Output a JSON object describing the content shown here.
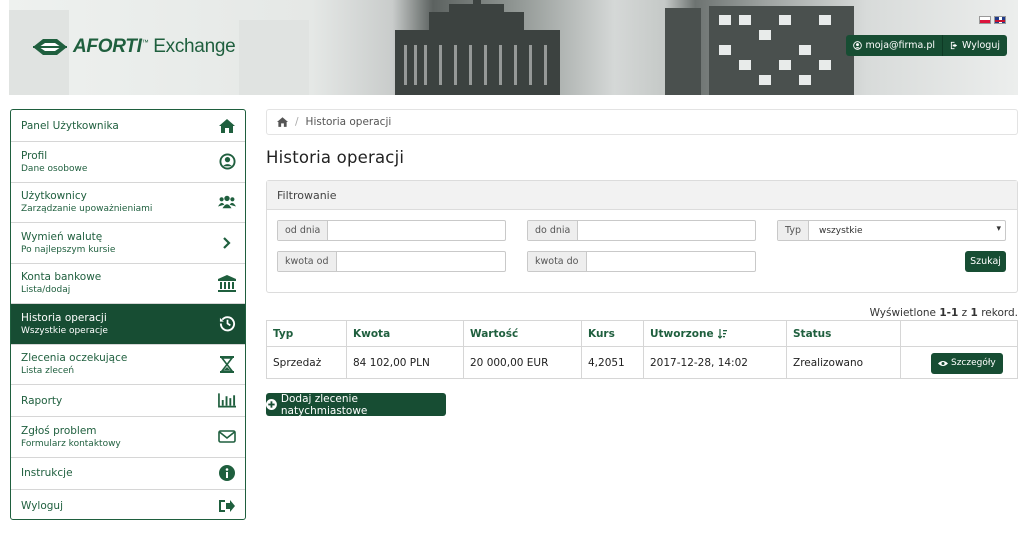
{
  "header": {
    "logo_brand": "AFORTI",
    "logo_tm": "™",
    "logo_suffix": "Exchange",
    "user_email": "moja@firma.pl",
    "logout_label": "Wyloguj",
    "languages": [
      "pl",
      "en"
    ]
  },
  "sidebar": {
    "items": [
      {
        "label": "Panel Użytkownika",
        "sub": "",
        "icon": "home-icon"
      },
      {
        "label": "Profil",
        "sub": "Dane osobowe",
        "icon": "user-circle-icon"
      },
      {
        "label": "Użytkownicy",
        "sub": "Zarządzanie upoważnieniami",
        "icon": "users-icon"
      },
      {
        "label": "Wymień walutę",
        "sub": "Po najlepszym kursie",
        "icon": "chevron-right-icon"
      },
      {
        "label": "Konta bankowe",
        "sub": "Lista/dodaj",
        "icon": "bank-icon"
      },
      {
        "label": "Historia operacji",
        "sub": "Wszystkie operacje",
        "icon": "history-icon",
        "active": true
      },
      {
        "label": "Zlecenia oczekujące",
        "sub": "Lista zleceń",
        "icon": "hourglass-icon"
      },
      {
        "label": "Raporty",
        "sub": "",
        "icon": "bar-chart-icon"
      },
      {
        "label": "Zgłoś problem",
        "sub": "Formularz kontaktowy",
        "icon": "envelope-icon"
      },
      {
        "label": "Instrukcje",
        "sub": "",
        "icon": "info-icon"
      },
      {
        "label": "Wyloguj",
        "sub": "",
        "icon": "sign-out-icon"
      }
    ]
  },
  "breadcrumb": {
    "current": "Historia operacji"
  },
  "page_title": "Historia operacji",
  "filter": {
    "title": "Filtrowanie",
    "from_date_label": "od dnia",
    "to_date_label": "do dnia",
    "type_label": "Typ",
    "type_value": "wszystkie",
    "amount_from_label": "kwota od",
    "amount_to_label": "kwota do",
    "search_label": "Szukaj"
  },
  "summary": {
    "prefix": "Wyświetlone",
    "range": "1-1",
    "mid": "z",
    "total": "1",
    "suffix": "rekord."
  },
  "table": {
    "columns": [
      "Typ",
      "Kwota",
      "Wartość",
      "Kurs",
      "Utworzone",
      "Status",
      ""
    ],
    "rows": [
      {
        "type": "Sprzedaż",
        "amount": "84 102,00 PLN",
        "value": "20 000,00 EUR",
        "rate": "4,2051",
        "created": "2017-12-28, 14:02",
        "status": "Zrealizowano",
        "action": "Szczegóły"
      }
    ]
  },
  "add_button": "Dodaj zlecenie natychmiastowe",
  "colors": {
    "brand": "#174d33",
    "brand_text": "#1f5f3e"
  }
}
